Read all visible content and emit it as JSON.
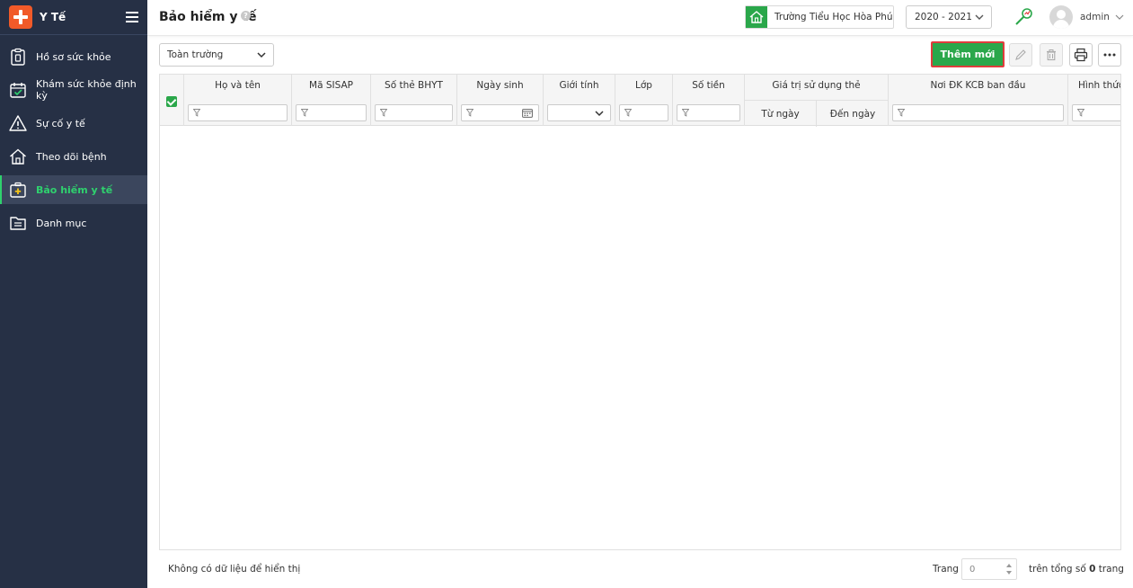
{
  "sidebar": {
    "app_title": "Y Tế",
    "items": [
      {
        "label": "Hồ sơ sức khỏe",
        "icon": "clipboard-icon"
      },
      {
        "label": "Khám sức khỏe định kỳ",
        "icon": "calendar-check-icon"
      },
      {
        "label": "Sự cố y tế",
        "icon": "warning-icon"
      },
      {
        "label": "Theo dõi bệnh",
        "icon": "house-icon"
      },
      {
        "label": "Bảo hiểm y tế",
        "icon": "medical-bag-icon",
        "active": true
      },
      {
        "label": "Danh mục",
        "icon": "folder-icon"
      }
    ]
  },
  "header": {
    "page_title": "Bảo hiểm y tế",
    "help": "?",
    "school": "Trường Tiểu Học Hòa Phú",
    "year": "2020 - 2021",
    "user": "admin"
  },
  "toolbar": {
    "scope_select": "Toàn trường",
    "add_label": "Thêm mới"
  },
  "grid": {
    "columns": {
      "name": "Họ và tên",
      "sisap": "Mã SISAP",
      "card": "Số thẻ BHYT",
      "dob": "Ngày sinh",
      "gender": "Giới tính",
      "class": "Lớp",
      "amount": "Số tiền",
      "validity": "Giá trị sử dụng thẻ",
      "from": "Từ ngày",
      "to": "Đến ngày",
      "place": "Nơi ĐK KCB ban đầu",
      "form": "Hình thức"
    }
  },
  "footer": {
    "empty_text": "Không có dữ liệu để hiển thị",
    "page_label": "Trang",
    "page_value": "0",
    "total_prefix": "trên tổng số",
    "total_pages": "0",
    "total_suffix": "trang"
  },
  "colors": {
    "sidebar_bg": "#263045",
    "accent_green": "#2aa74a",
    "active_text": "#2fd16e",
    "highlight_red": "#e03c3c"
  }
}
